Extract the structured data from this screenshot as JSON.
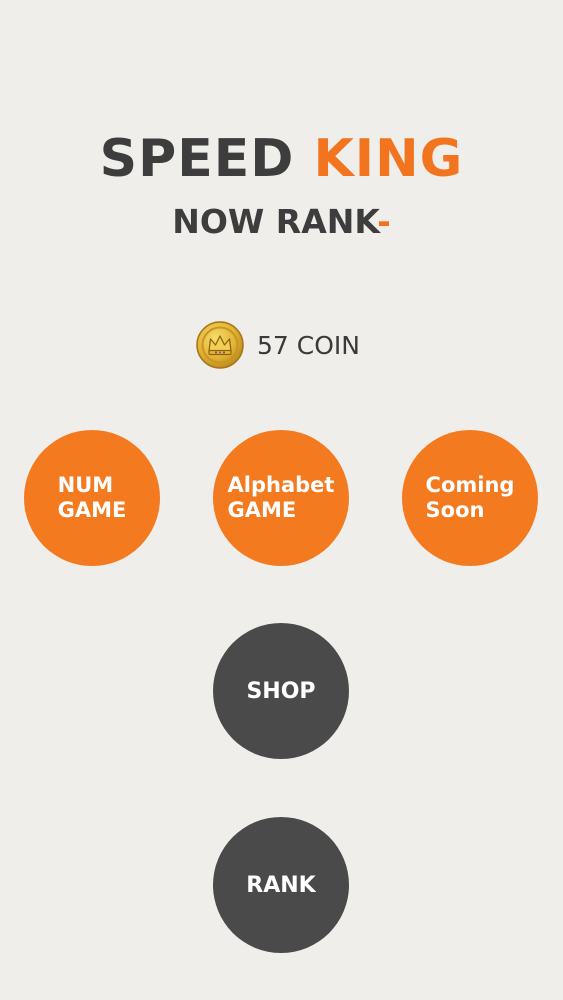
{
  "title": {
    "word1": "SPEED",
    "word2": "KING"
  },
  "subtitle": {
    "text": "NOW RANK",
    "rank_value": "-"
  },
  "coins": {
    "icon": "crown-coin-icon",
    "label": "57 COIN"
  },
  "modes": [
    {
      "line1": "NUM",
      "line2": "GAME"
    },
    {
      "line1": "Alphabet",
      "line2": "GAME"
    },
    {
      "line1": "Coming",
      "line2": "Soon"
    }
  ],
  "menu": {
    "shop_label": "SHOP",
    "rank_label": "RANK"
  },
  "colors": {
    "background": "#efeeea",
    "accent": "#f47a1f",
    "dark": "#4a4a4a",
    "title_dark": "#3d3d3d"
  }
}
